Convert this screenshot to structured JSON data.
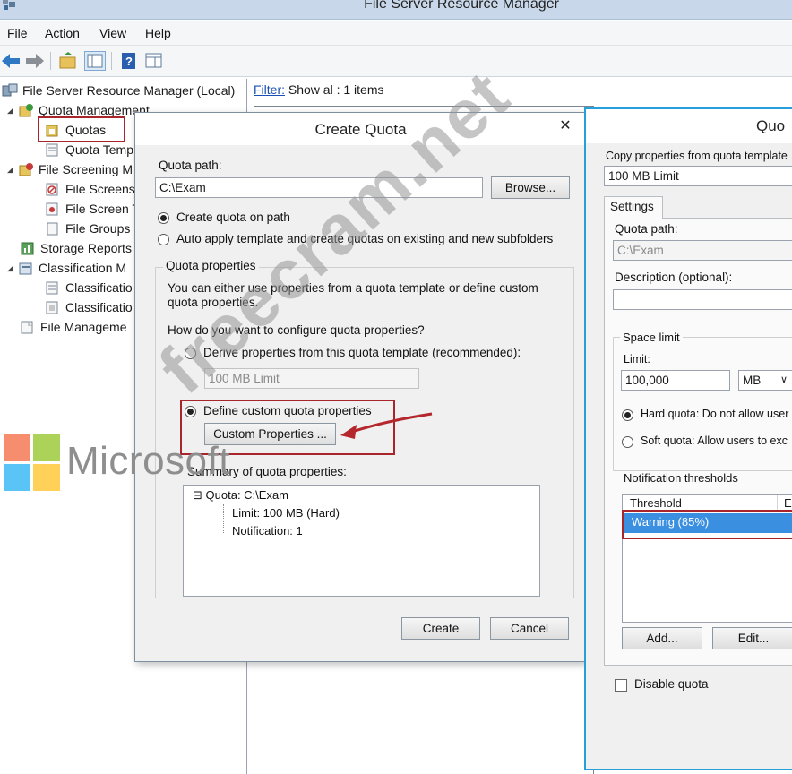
{
  "window": {
    "title": "File Server Resource Manager"
  },
  "menu": [
    "File",
    "Action",
    "View",
    "Help"
  ],
  "tree": {
    "root": "File Server Resource Manager (Local)",
    "items": [
      {
        "label": "Quota Management",
        "level": 1,
        "arrow": "◢"
      },
      {
        "label": "Quotas",
        "level": 2,
        "arrow": ""
      },
      {
        "label": "Quota Temp",
        "level": 2,
        "arrow": ""
      },
      {
        "label": "File Screening M",
        "level": 1,
        "arrow": "▷"
      },
      {
        "label": "File Screens",
        "level": 2,
        "arrow": ""
      },
      {
        "label": "File Screen T",
        "level": 2,
        "arrow": ""
      },
      {
        "label": "File Groups",
        "level": 2,
        "arrow": ""
      },
      {
        "label": "Storage Reports",
        "level": 1,
        "arrow": ""
      },
      {
        "label": "Classification M",
        "level": 1,
        "arrow": "◢"
      },
      {
        "label": "Classificatio",
        "level": 2,
        "arrow": ""
      },
      {
        "label": "Classificatio",
        "level": 2,
        "arrow": ""
      },
      {
        "label": "File Manageme",
        "level": 1,
        "arrow": ""
      }
    ]
  },
  "content": {
    "filter_label": "Filter:",
    "filter_value": "Show al : 1 items"
  },
  "create_quota": {
    "title": "Create Quota",
    "close": "✕",
    "quota_path_label": "Quota path:",
    "quota_path_value": "C:\\Exam",
    "browse": "Browse...",
    "radio_create": "Create quota on path",
    "radio_auto": "Auto apply template and create quotas on existing and new subfolders",
    "props_group": "Quota properties",
    "props_desc_1": "You can either use properties from a quota template or define custom",
    "props_desc_2": "quota properties.",
    "question": "How do you want to configure quota properties?",
    "radio_derive": "Derive properties from this quota template (recommended):",
    "template_value": "100 MB Limit",
    "radio_custom": "Define custom quota properties",
    "custom_btn": "Custom Properties ...",
    "summary_label": "Summary of quota properties:",
    "summary": {
      "root": "Quota: C:\\Exam",
      "limit": "Limit: 100 MB (Hard)",
      "notification": "Notification: 1"
    },
    "create_btn": "Create",
    "cancel_btn": "Cancel"
  },
  "quota_props": {
    "title": "Quo",
    "copy_label": "Copy properties from quota template",
    "copy_value": "100 MB Limit",
    "tab": "Settings",
    "path_label": "Quota path:",
    "path_value": "C:\\Exam",
    "desc_label": "Description (optional):",
    "space_group": "Space limit",
    "limit_label": "Limit:",
    "limit_value": "100,000",
    "unit": "MB",
    "hard_radio": "Hard quota: Do not allow user",
    "soft_radio": "Soft quota: Allow users to exc",
    "notif_group": "Notification thresholds",
    "col_threshold": "Threshold",
    "col_e": "E",
    "row_warning": "Warning (85%)",
    "add_btn": "Add...",
    "edit_btn": "Edit...",
    "disable_label": "Disable quota"
  },
  "overlay": {
    "brand": "Microsoft",
    "watermark": "freecram.net",
    "brand_colors": {
      "red": "#f25022",
      "green": "#7fba00",
      "blue": "#00a4ef",
      "yellow": "#ffb900"
    }
  }
}
